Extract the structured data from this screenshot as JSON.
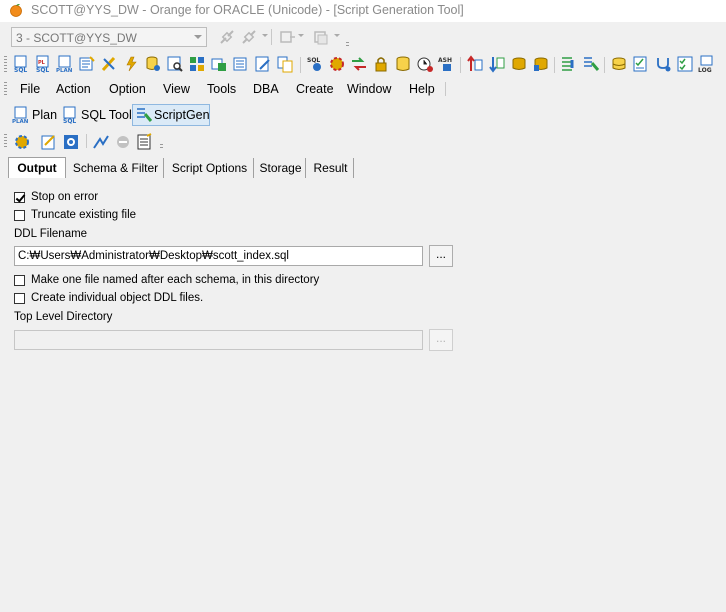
{
  "window": {
    "title": "SCOTT@YYS_DW - Orange for ORACLE (Unicode) - [Script Generation Tool]"
  },
  "connection_toolbar": {
    "connection_selected": "3 - SCOTT@YYS_DW"
  },
  "menu": {
    "items": [
      "File",
      "Action",
      "Option",
      "View",
      "Tools",
      "DBA",
      "Create",
      "Window",
      "Help"
    ]
  },
  "tool_tabs": {
    "plan": "Plan",
    "sql_tool": "SQL Tool",
    "scriptgen": "ScriptGen"
  },
  "tabs": {
    "items": [
      "Output",
      "Schema & Filter",
      "Script Options",
      "Storage",
      "Result"
    ],
    "active": "Output"
  },
  "output": {
    "stop_on_error": {
      "label": "Stop on error",
      "checked": true
    },
    "truncate_existing": {
      "label": "Truncate existing file",
      "checked": false
    },
    "ddl_filename_label": "DDL Filename",
    "ddl_filename_value": "C:₩Users₩Administrator₩Desktop₩scott_index.sql",
    "browse_label": "...",
    "one_file_per_schema": {
      "label": "Make one file named after  each schema, in this directory",
      "checked": false
    },
    "individual_ddl": {
      "label": "Create individual object DDL files.",
      "checked": false
    },
    "top_level_dir_label": "Top Level Directory",
    "top_level_dir_value": "",
    "top_browse_label": "..."
  },
  "colors": {
    "active_tool_bg": "#dbeaf7",
    "icon_blue": "#2a6fc4",
    "icon_yellow": "#e0a800",
    "icon_green": "#2f9e44",
    "icon_red": "#c62828"
  }
}
